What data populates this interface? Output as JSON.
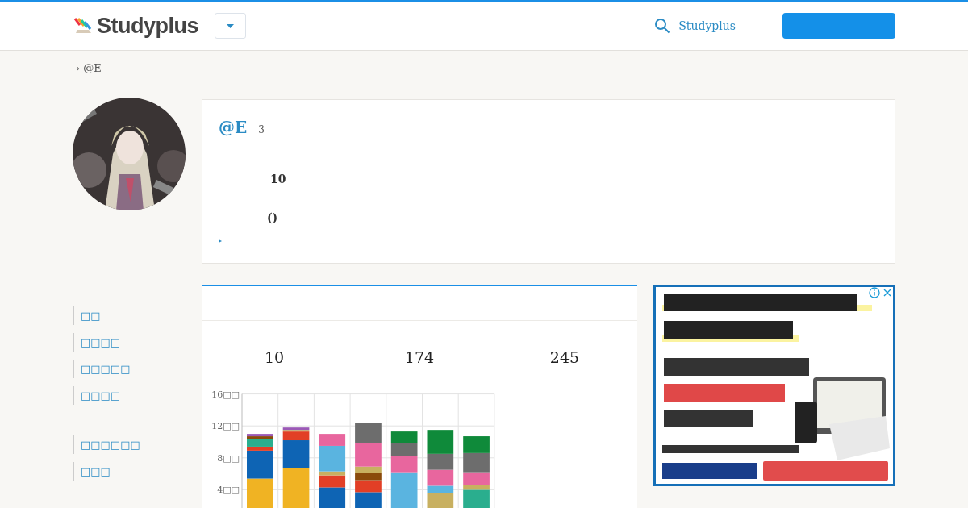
{
  "header": {
    "logo": "Studyplus",
    "search_link": "Studyplus"
  },
  "breadcrumb": "› @E",
  "profile": {
    "name": "@E",
    "count": "3",
    "stat": "10",
    "note": "()",
    "toggle": "▸"
  },
  "sidebar": {
    "groups": [
      {
        "items": [
          {
            "label": "□□"
          },
          {
            "label": "□□□□"
          },
          {
            "label": "□□□□□"
          },
          {
            "label": "□□□□"
          }
        ]
      },
      {
        "items": [
          {
            "label": "□□□□□□"
          },
          {
            "label": "□□□"
          }
        ]
      }
    ]
  },
  "stats": [
    "10",
    "174",
    "245"
  ],
  "chart_data": {
    "type": "bar",
    "stacked": true,
    "ylim": [
      0,
      16
    ],
    "yticks": [
      {
        "value": 4,
        "label": "4□□"
      },
      {
        "value": 8,
        "label": "8□□"
      },
      {
        "value": 12,
        "label": "12□□"
      },
      {
        "value": 16,
        "label": "16□□"
      }
    ],
    "grid": true,
    "series": [
      {
        "color": "#f0b323",
        "values": [
          5.4,
          6.7,
          0,
          0,
          0,
          0,
          0
        ]
      },
      {
        "color": "#0e64b4",
        "values": [
          3.5,
          3.5,
          4.3,
          3.7,
          0,
          0,
          0
        ]
      },
      {
        "color": "#e23f26",
        "values": [
          0.5,
          1.1,
          1.5,
          1.5,
          0,
          0,
          0
        ]
      },
      {
        "color": "#2aae8e",
        "values": [
          1.0,
          0,
          0,
          0,
          0,
          0,
          4.0
        ]
      },
      {
        "color": "#8a4a0b",
        "values": [
          0.3,
          0,
          0,
          0.9,
          0,
          0,
          0
        ]
      },
      {
        "color": "#c8b060",
        "values": [
          0,
          0.2,
          0.5,
          0.8,
          0,
          3.6,
          0.6
        ]
      },
      {
        "color": "#5ab4e0",
        "values": [
          0,
          0,
          3.2,
          0,
          6.2,
          0.9,
          0
        ]
      },
      {
        "color": "#e8669e",
        "values": [
          0,
          0,
          1.5,
          3.0,
          2.0,
          2.0,
          1.6
        ]
      },
      {
        "color": "#6d6d6d",
        "values": [
          0,
          0,
          0,
          2.5,
          1.6,
          2.0,
          2.4
        ]
      },
      {
        "color": "#0f8a3a",
        "values": [
          0,
          0,
          0,
          0,
          1.5,
          3.0,
          2.1
        ]
      },
      {
        "color": "#9b59b6",
        "values": [
          0.3,
          0.3,
          0,
          0,
          0,
          0,
          0
        ]
      }
    ]
  },
  "ad": {
    "kind": "picture"
  }
}
